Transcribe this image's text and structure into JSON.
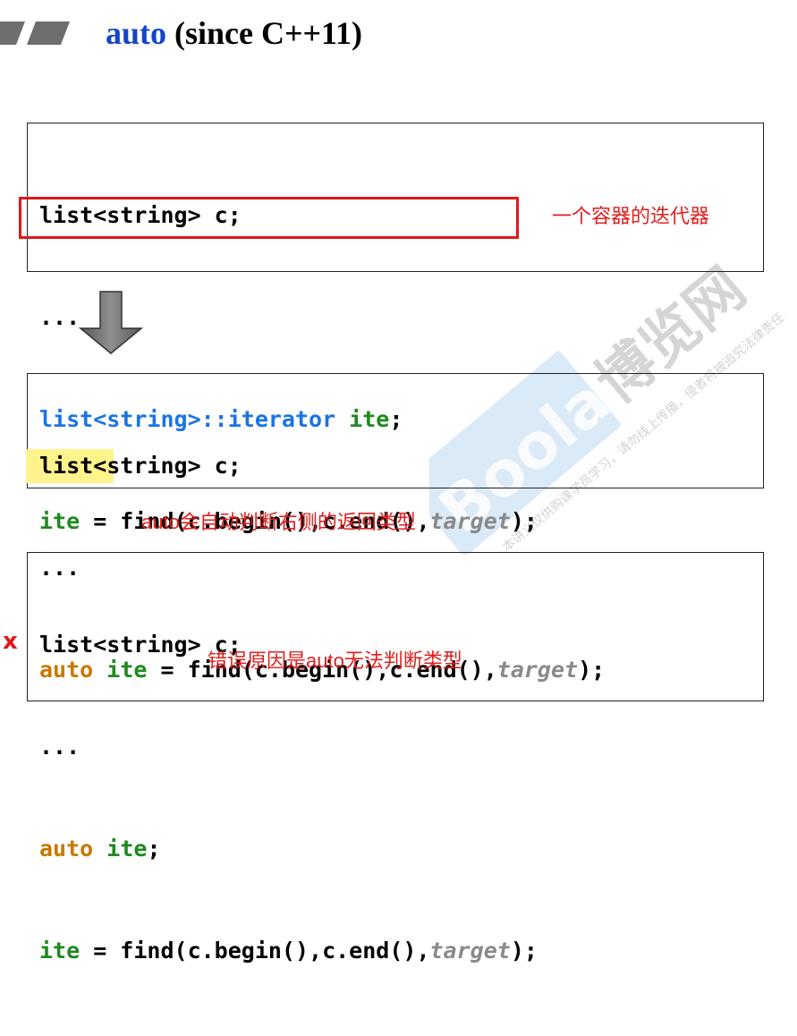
{
  "title": {
    "keyword": "auto",
    "rest": " (since C++11)"
  },
  "block1": {
    "line1": "list<string> c;",
    "line2": "...",
    "line3_type": "list<string>::iterator ",
    "line3_var": "ite",
    "line3_end": ";",
    "line4_var": "ite",
    "line4_mid": " = find(c.begin(),c.end(),",
    "line4_arg": "target",
    "line4_end": ");"
  },
  "annotation1": "一个容器的迭代器",
  "block2": {
    "line1": "list<string> c;",
    "line2": "...",
    "line3_kw": "auto",
    "line3_var": "ite",
    "line3_mid": " = find(c.begin(),c.end(),",
    "line3_arg": "target",
    "line3_end": ");"
  },
  "annotation2": "auto会自动判断右侧的返回类型",
  "block3": {
    "line1": "list<string> c;",
    "line2": "...",
    "line3_kw": "auto",
    "line3_var": "ite",
    "line3_end": ";",
    "line4_var": "ite",
    "line4_mid": " = find(c.begin(),c.end(),",
    "line4_arg": "target",
    "line4_end": ");"
  },
  "error_mark": "x",
  "annotation3": "错误原因是auto无法判断类型",
  "watermark": {
    "brand": "Boolan",
    "cn_name": "博览网",
    "notice": "本讲义仅供购课学员学习，请勿线上传播，侵者将被追究法律责任"
  },
  "colors": {
    "keyword_blue": "#1446c8",
    "iterator_blue": "#1b74e4",
    "ident_green": "#1f8a1f",
    "auto_orange": "#c87800",
    "arg_grey": "#8a8a8a",
    "annotation_red": "#e02020",
    "highlight_yellow": "#fff38c"
  }
}
